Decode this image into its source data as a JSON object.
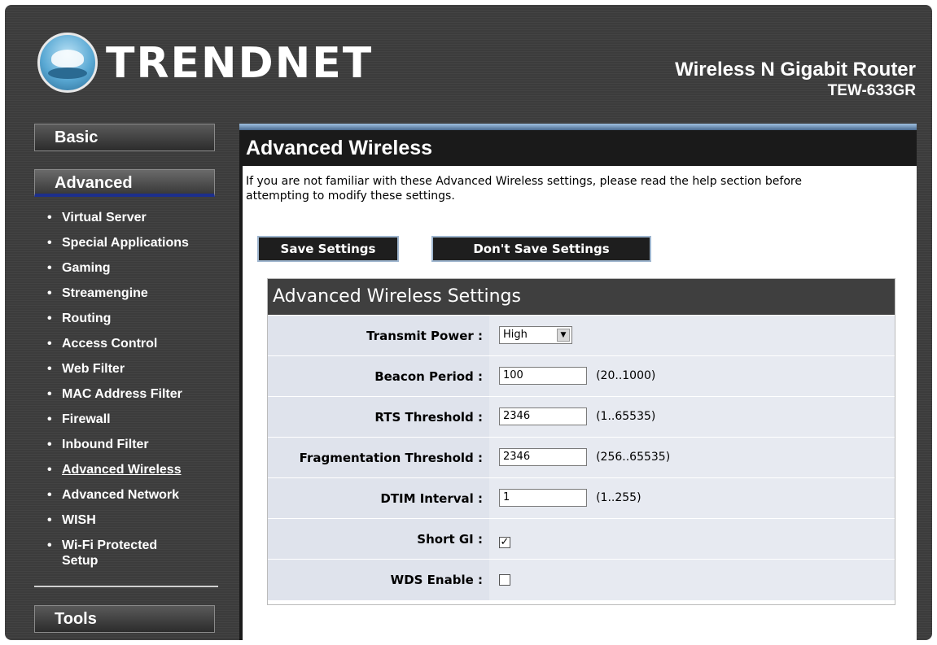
{
  "header": {
    "logo_text": "TRENDNET",
    "product_name": "Wireless N Gigabit Router",
    "model": "TEW-633GR"
  },
  "sidebar": {
    "basic_label": "Basic",
    "advanced_label": "Advanced",
    "tools_label": "Tools",
    "items": [
      {
        "label": "Virtual Server"
      },
      {
        "label": "Special Applications"
      },
      {
        "label": "Gaming"
      },
      {
        "label": "Streamengine"
      },
      {
        "label": "Routing"
      },
      {
        "label": "Access Control"
      },
      {
        "label": "Web Filter"
      },
      {
        "label": "MAC Address Filter"
      },
      {
        "label": "Firewall"
      },
      {
        "label": "Inbound Filter"
      },
      {
        "label": "Advanced Wireless"
      },
      {
        "label": "Advanced Network"
      },
      {
        "label": "WISH"
      },
      {
        "label": "Wi-Fi Protected"
      },
      {
        "label": "Setup"
      }
    ]
  },
  "main": {
    "title": "Advanced Wireless",
    "intro_line1": "If you are not familiar with these Advanced Wireless settings, please read the help section before",
    "intro_line2": "attempting to modify these settings.",
    "save_label": "Save Settings",
    "dont_save_label": "Don't Save Settings",
    "panel_title": "Advanced Wireless Settings",
    "fields": {
      "transmit_power": {
        "label": "Transmit Power :",
        "value": "High"
      },
      "beacon_period": {
        "label": "Beacon Period :",
        "value": "100",
        "range": "(20..1000)"
      },
      "rts_threshold": {
        "label": "RTS Threshold :",
        "value": "2346",
        "range": "(1..65535)"
      },
      "fragmentation_threshold": {
        "label": "Fragmentation Threshold :",
        "value": "2346",
        "range": "(256..65535)"
      },
      "dtim_interval": {
        "label": "DTIM Interval :",
        "value": "1",
        "range": "(1..255)"
      },
      "short_gi": {
        "label": "Short GI :",
        "checked": true
      },
      "wds_enable": {
        "label": "WDS Enable :",
        "checked": false
      }
    }
  },
  "icons": {
    "dropdown": "chevron-down-icon",
    "check": "✓"
  },
  "colors": {
    "active_underline": "#1c2f8c",
    "accent_bar": "#9fc0e0"
  }
}
